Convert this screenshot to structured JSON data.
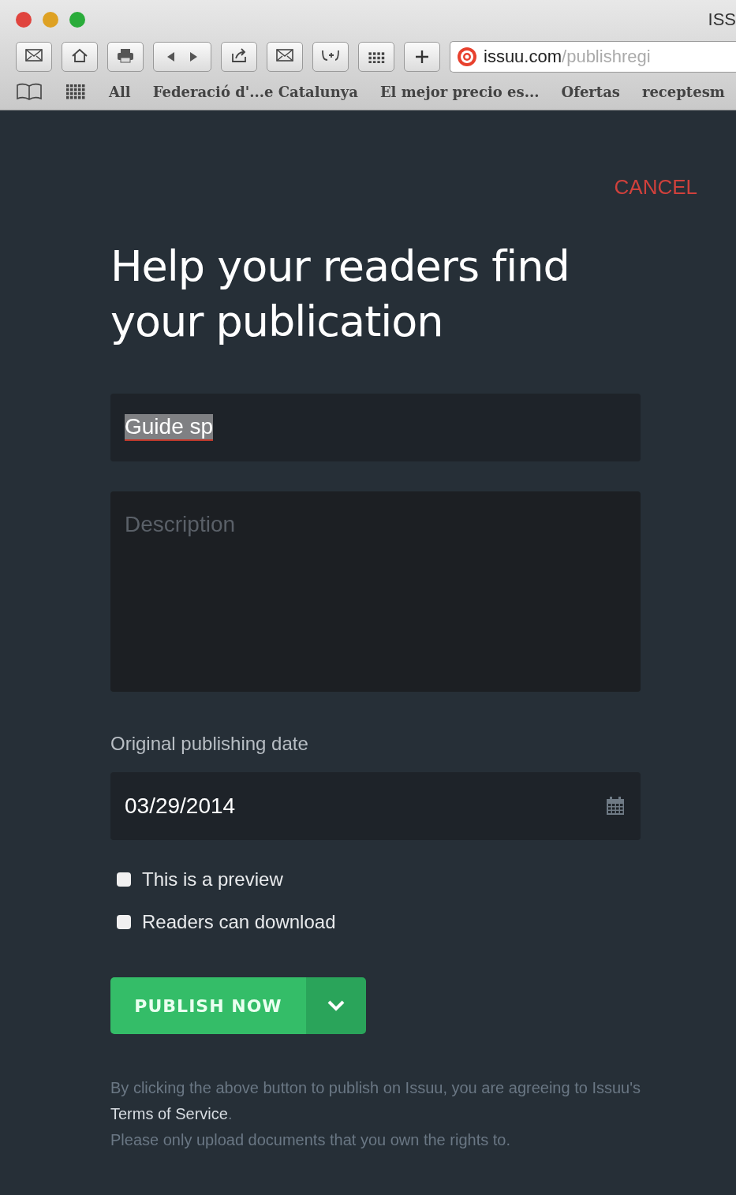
{
  "browser": {
    "window_title": "ISS",
    "address": {
      "domain": "issuu.com",
      "path": "/publishregi"
    },
    "toolbar": [
      {
        "kind": "mail"
      },
      {
        "kind": "home"
      },
      {
        "kind": "print"
      },
      {
        "kind": "backforward"
      },
      {
        "kind": "share"
      },
      {
        "kind": "mail"
      },
      {
        "kind": "reader"
      },
      {
        "kind": "grid"
      },
      {
        "kind": "plus"
      }
    ],
    "bookmarks": [
      "All",
      "Federació d'...e Catalunya",
      "El mejor precio es...",
      "Ofertas",
      "receptesm"
    ]
  },
  "page": {
    "cancel": "CANCEL",
    "heading": "Help your readers find your publication",
    "title_field": {
      "value": "Guide sp",
      "text_selected": true
    },
    "description_field": {
      "placeholder": "Description"
    },
    "date_label": "Original publishing date",
    "date_field": {
      "value": "03/29/2014"
    },
    "checkboxes": [
      {
        "label": "This is a preview",
        "checked": false
      },
      {
        "label": "Readers can download",
        "checked": false
      }
    ],
    "publish_button": "PUBLISH NOW",
    "terms": {
      "before": "By clicking the above button to publish on Issuu, you are agreeing to Issuu's",
      "link": "Terms of Service",
      "after": "."
    },
    "rights_note": "Please only upload documents that you own the rights to."
  }
}
